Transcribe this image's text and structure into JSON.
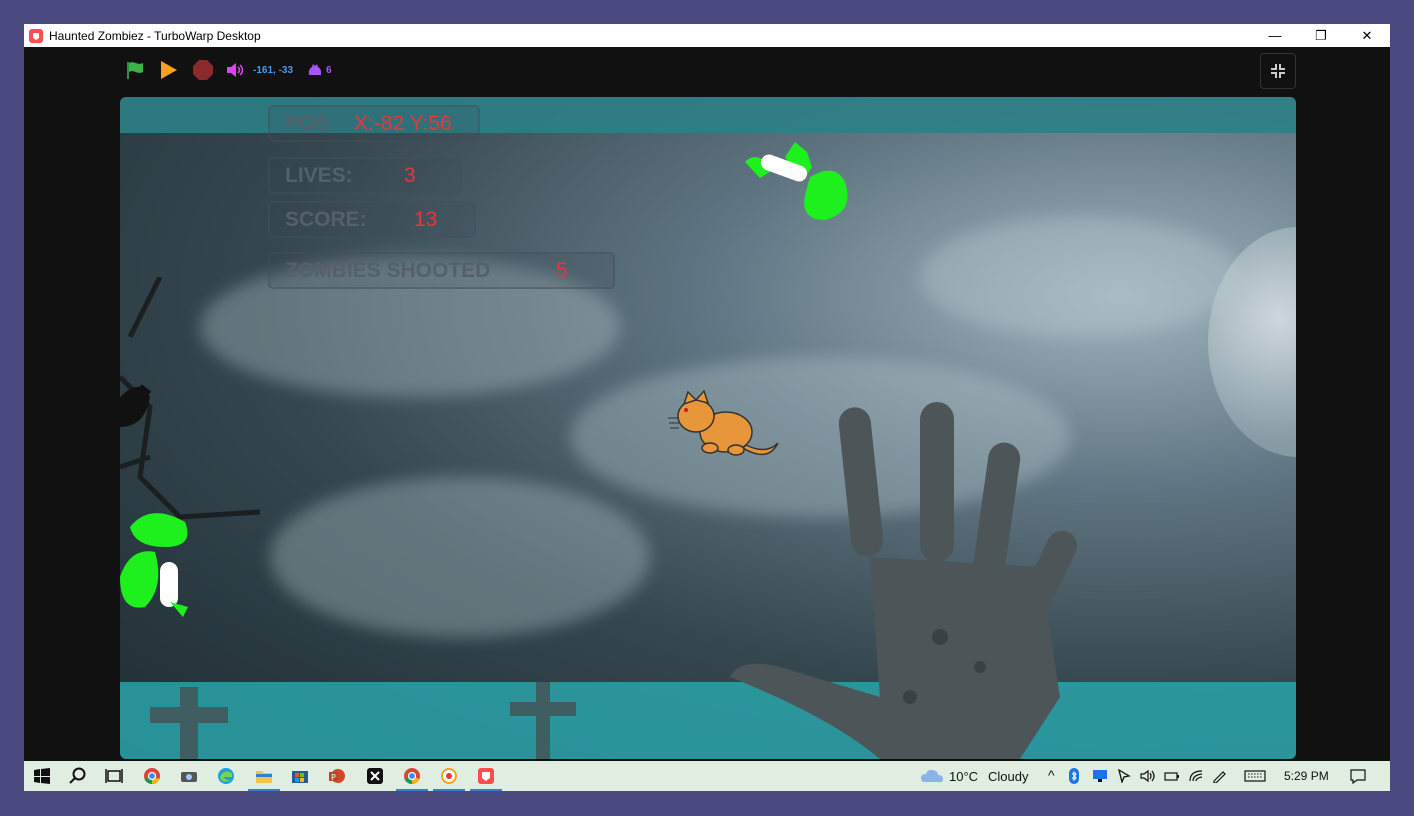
{
  "window": {
    "title": "Haunted Zombiez - TurboWarp Desktop",
    "controls": {
      "minimize": "—",
      "restore": "❐",
      "close": "✕"
    }
  },
  "toolbar": {
    "green_flag_icon": "green-flag-icon",
    "pause_icon": "play-pause-icon",
    "stop_icon": "stop-icon",
    "sound_icon": "sound-icon",
    "mouse_coords": "-161, -33",
    "clone_count": "6",
    "colors": {
      "flag": "#3bb54a",
      "pause": "#f7a11c",
      "stop": "#8b2a2a",
      "accent": "#4c9be8",
      "clone": "#a855f7"
    }
  },
  "hud": {
    "pos": {
      "label": "POS",
      "value": "X:-82 Y:56"
    },
    "lives": {
      "label": "LIVES:",
      "value": "3"
    },
    "score": {
      "label": "SCORE:",
      "value": "13"
    },
    "zombies": {
      "label": "ZOMBIES SHOOTED",
      "value": "5"
    }
  },
  "taskbar": {
    "weather": {
      "temp": "10°C",
      "condition": "Cloudy"
    },
    "clock": "5:29 PM",
    "apps": [
      "start-icon",
      "search-icon",
      "task-view-icon",
      "chrome-icon",
      "camera-icon",
      "edge-icon",
      "file-explorer-icon",
      "store-icon",
      "powerpoint-icon",
      "capcut-icon",
      "chrome-profile-icon",
      "scratch-icon",
      "turbowarp-icon"
    ]
  }
}
